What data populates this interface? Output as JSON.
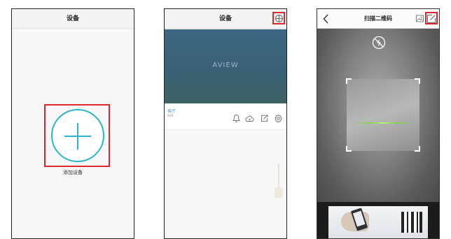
{
  "panel1": {
    "title": "设备",
    "add_label": "添加设备",
    "icons": {
      "add": "plus-circle-icon"
    }
  },
  "panel2": {
    "title": "设备",
    "preview_text": "AVIEW",
    "device": {
      "name": "客厅",
      "type": "NVR"
    },
    "icons": {
      "add": "plus-circle-icon",
      "alarm": "bell-icon",
      "cloud": "cloud-play-icon",
      "share": "share-icon",
      "settings": "gear-icon"
    }
  },
  "panel3": {
    "title": "扫描二维码",
    "icons": {
      "back": "back-chevron-icon",
      "album": "album-icon",
      "manual": "edit-icon",
      "flash": "flash-off-icon"
    }
  },
  "colors": {
    "highlight": "#e0262c",
    "accent": "#29b6c8",
    "scan_line": "#7ad54a",
    "device_name": "#4aa3d8"
  }
}
